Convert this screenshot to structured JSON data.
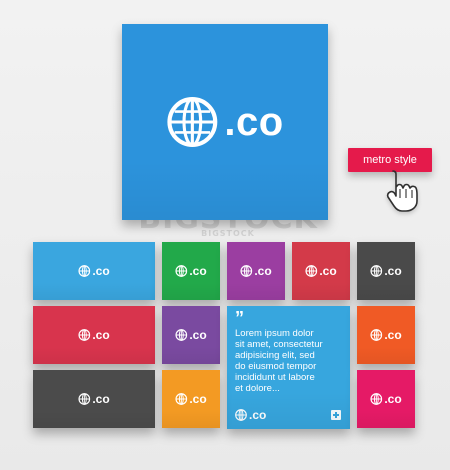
{
  "hero": {
    "label": ".co",
    "color": "#2c93dc"
  },
  "badge": {
    "label": "metro style",
    "color": "#e51a4b"
  },
  "watermark": {
    "text": "BIGSTOCK",
    "subtext": "BIGSTOCK"
  },
  "tiles": [
    {
      "label": ".co",
      "color": "#3aa6df",
      "icon": "globe-icon"
    },
    {
      "label": ".co",
      "color": "#22a94a",
      "icon": "globe-icon"
    },
    {
      "label": ".co",
      "color": "#9b3ea1",
      "icon": "globe-icon"
    },
    {
      "label": ".co",
      "color": "#d33a49",
      "icon": "globe-icon"
    },
    {
      "label": ".co",
      "color": "#4a4a4a",
      "icon": "globe-icon"
    },
    {
      "label": ".co",
      "color": "#d8344d",
      "icon": "globe-icon"
    },
    {
      "label": ".co",
      "color": "#7a4aa0",
      "icon": "globe-icon"
    },
    {
      "label": ".co",
      "color": "#f05a25",
      "icon": "globe-icon"
    },
    {
      "label": ".co",
      "color": "#4b4b4b",
      "icon": "globe-icon"
    },
    {
      "label": ".co",
      "color": "#f39a23",
      "icon": "globe-icon"
    },
    {
      "label": ".co",
      "color": "#e51a66",
      "icon": "globe-icon"
    }
  ],
  "copy_tile": {
    "quote": "”",
    "text": "Lorem ipsum dolor\nsit amet, consectetur\nadipisicing elit, sed\ndo eiusmod tempor\nincididunt ut labore\net dolore...",
    "label": ".co",
    "color": "#37a6de",
    "plus_icon": "plus-icon"
  }
}
